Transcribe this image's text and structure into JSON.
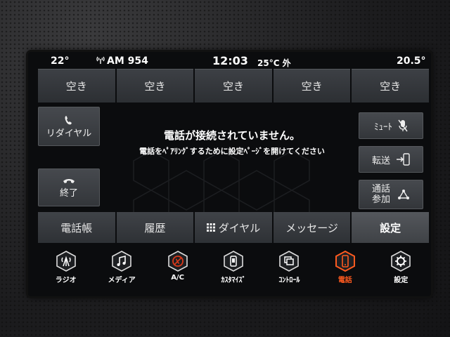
{
  "status": {
    "temp_left": "22°",
    "radio": "AM 954",
    "time": "12:03",
    "outside": "25°C 外",
    "temp_right": "20.5°"
  },
  "presets": [
    "空き",
    "空き",
    "空き",
    "空き",
    "空き"
  ],
  "buttons": {
    "redial": "リダイヤル",
    "hangup": "終了",
    "mute": "ﾐｭｰﾄ",
    "transfer": "転送",
    "conference_line1": "通話",
    "conference_line2": "参加"
  },
  "message": {
    "title": "電話が接続されていません。",
    "subtitle": "電話をﾍﾟｱﾘﾝｸﾞするために設定ﾍﾟｰｼﾞを開けてください"
  },
  "tabs": [
    "電話帳",
    "履歴",
    "ダイヤル",
    "メッセージ",
    "設定"
  ],
  "nav": [
    {
      "label": "ラジオ",
      "icon": "radio-tower-icon"
    },
    {
      "label": "メディア",
      "icon": "music-note-icon"
    },
    {
      "label": "A/C",
      "icon": "climate-off-icon"
    },
    {
      "label": "ｶｽﾀﾏｲｽﾞ",
      "icon": "customize-icon"
    },
    {
      "label": "ｺﾝﾄﾛｰﾙ",
      "icon": "controls-icon"
    },
    {
      "label": "電話",
      "icon": "phone-icon"
    },
    {
      "label": "設定",
      "icon": "gear-icon"
    }
  ],
  "colors": {
    "accent": "#ff5a1f",
    "text": "#ffffff",
    "button_bg": "#3d4045"
  }
}
